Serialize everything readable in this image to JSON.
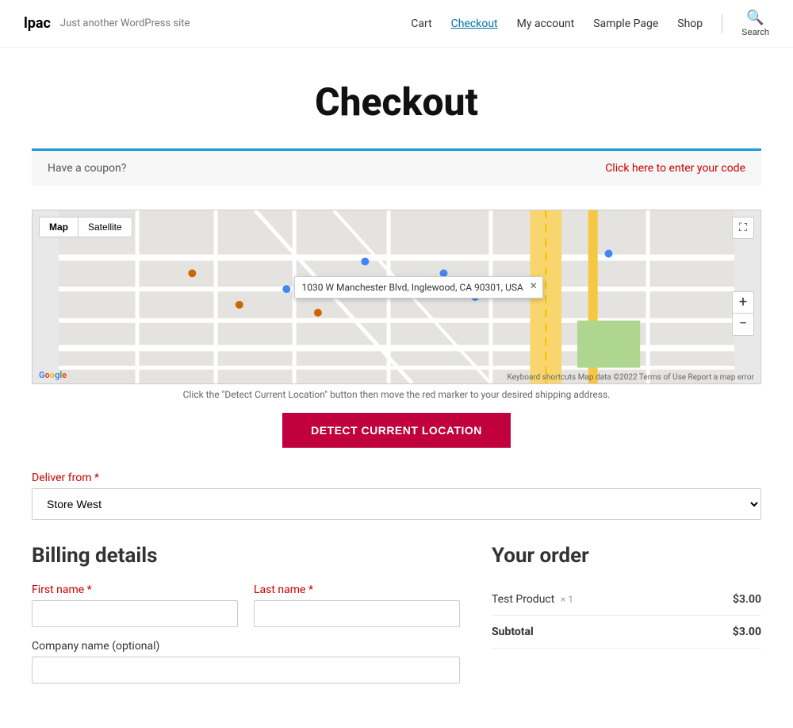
{
  "header": {
    "site_title": "lpac",
    "site_tagline": "Just another WordPress site",
    "nav_links": [
      {
        "label": "Cart",
        "active": false
      },
      {
        "label": "Checkout",
        "active": true
      },
      {
        "label": "My account",
        "active": false
      },
      {
        "label": "Sample Page",
        "active": false
      },
      {
        "label": "Shop",
        "active": false
      }
    ],
    "search_label": "Search"
  },
  "page": {
    "title": "Checkout"
  },
  "coupon": {
    "text": "Have a coupon?",
    "link_text": "Click here to enter your code"
  },
  "map": {
    "tab_map": "Map",
    "tab_satellite": "Satellite",
    "info_address": "1030 W Manchester Blvd, Inglewood, CA 90301, USA",
    "hint": "Click the \"Detect Current Location\" button then move the red marker to your desired shipping address.",
    "attribution": "Keyboard shortcuts  Map data ©2022  Terms of Use  Report a map error"
  },
  "detect_button": {
    "label": "DETECT CURRENT LOCATION"
  },
  "deliver_from": {
    "label": "Deliver from",
    "required": "*",
    "options": [
      "Store West"
    ],
    "selected": "Store West"
  },
  "billing": {
    "title": "Billing details",
    "first_name_label": "First name",
    "first_name_required": "*",
    "last_name_label": "Last name",
    "last_name_required": "*",
    "company_label": "Company name (optional)"
  },
  "order": {
    "title": "Your order",
    "item_name": "Test Product",
    "item_qty": "× 1",
    "item_price": "$3.00",
    "subtotal_label": "Subtotal",
    "subtotal_value": "$3.00"
  }
}
